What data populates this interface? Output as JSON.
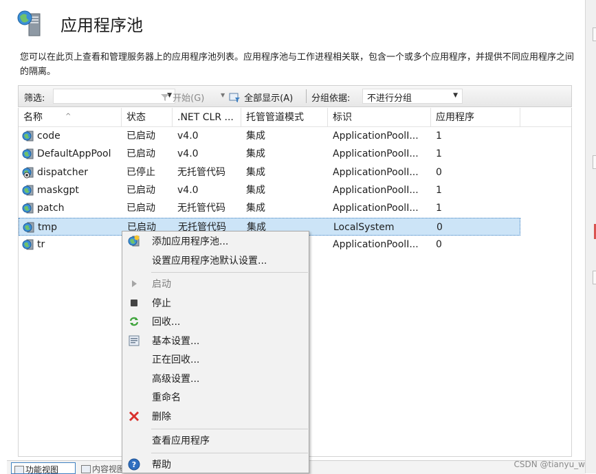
{
  "page": {
    "title": "应用程序池",
    "description": "您可以在此页上查看和管理服务器上的应用程序池列表。应用程序池与工作进程相关联，包含一个或多个应用程序，并提供不同应用程序之间的隔离。"
  },
  "filterbar": {
    "filter_label": "筛选:",
    "start_label": "开始(G)",
    "show_all_label": "全部显示(A)",
    "group_label": "分组依据:",
    "group_value": "不进行分组"
  },
  "grid": {
    "columns": [
      "名称",
      "状态",
      ".NET CLR ...",
      "托管管道模式",
      "标识",
      "应用程序"
    ],
    "rows": [
      {
        "name": "code",
        "status": "已启动",
        "clr": "v4.0",
        "pipeline": "集成",
        "identity": "ApplicationPoolI...",
        "apps": "1"
      },
      {
        "name": "DefaultAppPool",
        "status": "已启动",
        "clr": "v4.0",
        "pipeline": "集成",
        "identity": "ApplicationPoolI...",
        "apps": "1"
      },
      {
        "name": "dispatcher",
        "status": "已停止",
        "clr": "无托管代码",
        "pipeline": "集成",
        "identity": "ApplicationPoolI...",
        "apps": "0"
      },
      {
        "name": "maskgpt",
        "status": "已启动",
        "clr": "v4.0",
        "pipeline": "集成",
        "identity": "ApplicationPoolI...",
        "apps": "1"
      },
      {
        "name": "patch",
        "status": "已启动",
        "clr": "无托管代码",
        "pipeline": "集成",
        "identity": "ApplicationPoolI...",
        "apps": "1"
      },
      {
        "name": "tmp",
        "status": "已启动",
        "clr": "无托管代码",
        "pipeline": "集成",
        "identity": "LocalSystem",
        "apps": "0"
      },
      {
        "name": "tr",
        "status": "",
        "clr": "",
        "pipeline": "",
        "identity": "ApplicationPoolI...",
        "apps": "0"
      }
    ]
  },
  "context_menu": {
    "items": [
      {
        "label": "添加应用程序池...",
        "icon": "add-pool-icon"
      },
      {
        "label": "设置应用程序池默认设置...",
        "icon": ""
      },
      {
        "label": "启动",
        "icon": "play-icon",
        "disabled": true
      },
      {
        "label": "停止",
        "icon": "stop-icon"
      },
      {
        "label": "回收...",
        "icon": "recycle-icon"
      },
      {
        "label": "基本设置...",
        "icon": "settings-icon"
      },
      {
        "label": "正在回收...",
        "icon": ""
      },
      {
        "label": "高级设置...",
        "icon": ""
      },
      {
        "label": "重命名",
        "icon": ""
      },
      {
        "label": "删除",
        "icon": "delete-icon"
      },
      {
        "label": "查看应用程序",
        "icon": ""
      },
      {
        "label": "帮助",
        "icon": "help-icon"
      }
    ]
  },
  "bottom": {
    "tab_features": "功能视图",
    "tab_content": "内容视图",
    "watermark": "CSDN @tianyu_w"
  },
  "colors": {
    "selection": "#cce4f7",
    "accent": "#3c7fc1",
    "delete_red": "#d9302c"
  }
}
